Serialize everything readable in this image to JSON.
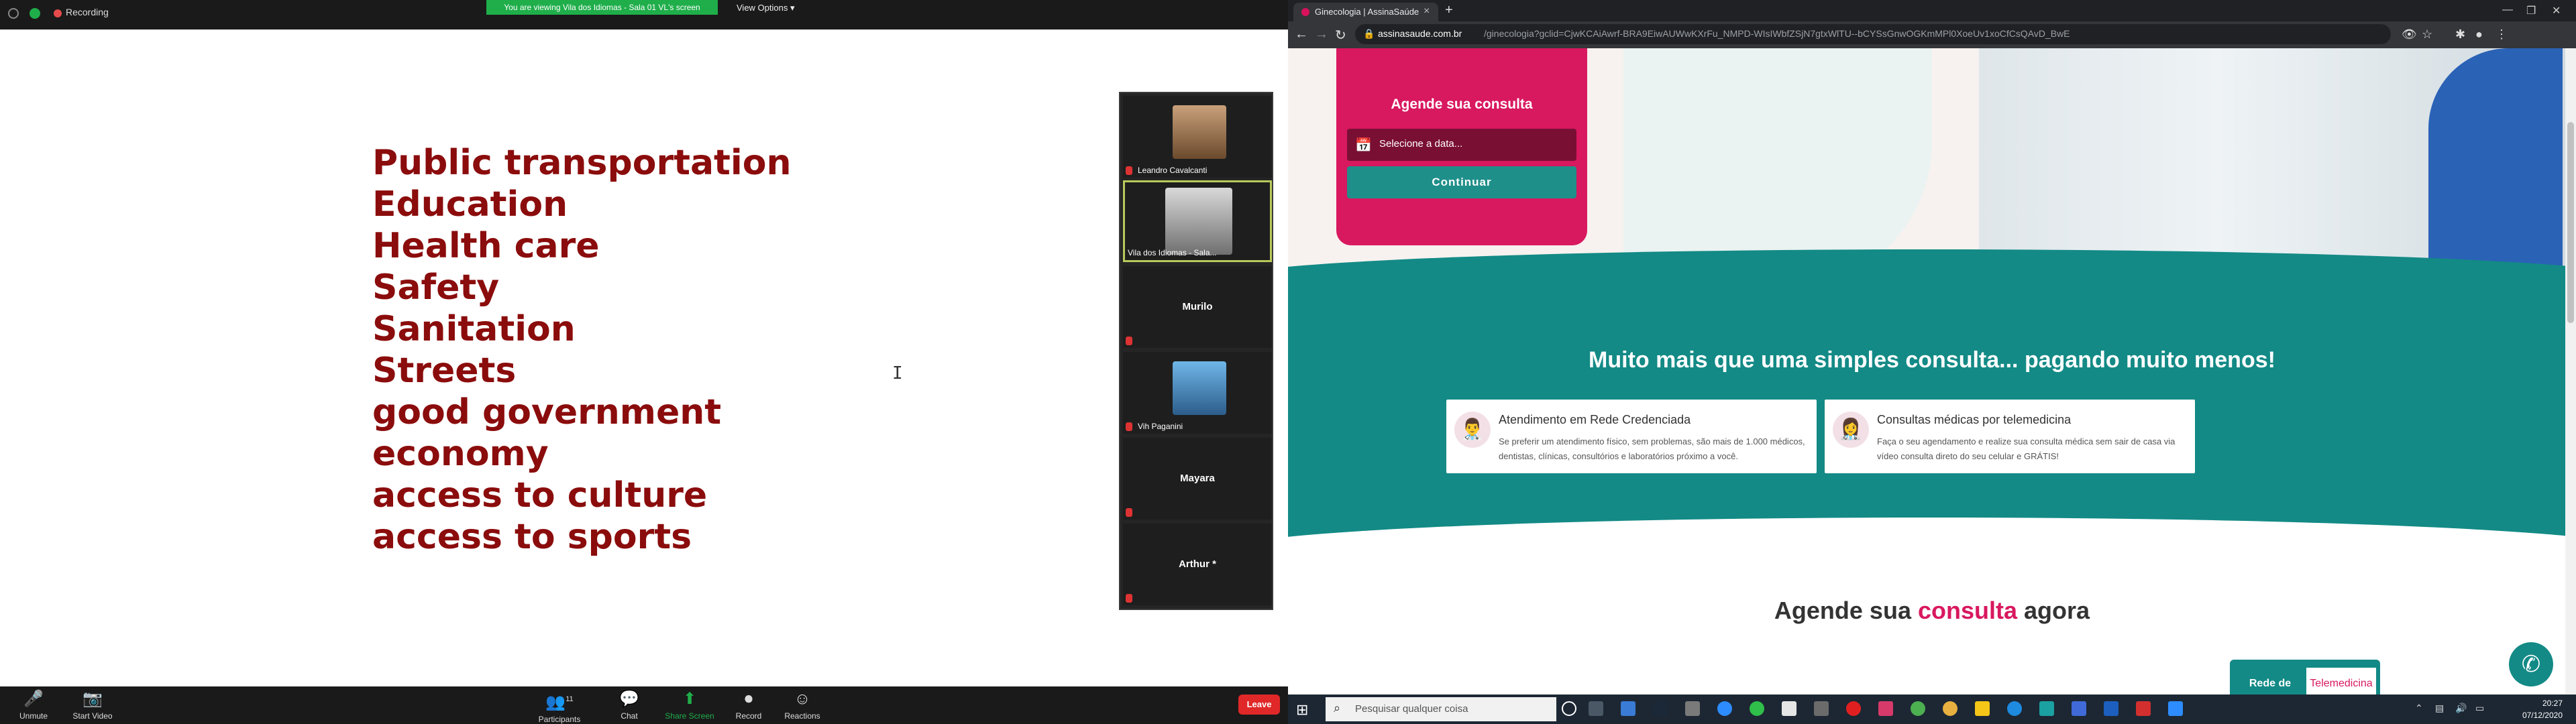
{
  "zoom": {
    "recording_label": "Recording",
    "viewing_banner": "You are viewing Vila dos Idiomas - Sala 01 VL's screen",
    "view_options": "View Options",
    "slide_lines": [
      "Public transportation",
      "Education",
      "Health care",
      "Safety",
      "Sanitation",
      "Streets",
      "good government",
      "economy",
      "access to culture",
      "access to sports"
    ],
    "participants": [
      {
        "name": "Leandro Cavalcanti",
        "center": ""
      },
      {
        "name": "Vila dos Idiomas - Sala...",
        "center": ""
      },
      {
        "name": "",
        "center": "Murilo"
      },
      {
        "name": "Vih Paganini",
        "center": ""
      },
      {
        "name": "",
        "center": "Mayara"
      },
      {
        "name": "",
        "center": "Arthur *"
      }
    ],
    "toolbar": {
      "unmute": "Unmute",
      "start_video": "Start Video",
      "participants": "Participants",
      "participants_count": "11",
      "chat": "Chat",
      "share_screen": "Share Screen",
      "record": "Record",
      "reactions": "Reactions",
      "leave": "Leave"
    }
  },
  "browser": {
    "tab_title": "Ginecologia | AssinaSaúde",
    "url_host": "assinasaude.com.br",
    "url_path": "/ginecologia?gclid=CjwKCAiAwrf-BRA9EiwAUWwKXrFu_NMPD-WIsIWbfZSjN7gtxWlTU--bCYSsGnwOGKmMPl0XoeUv1xoCfCsQAvD_BwE",
    "booking": {
      "title": "Agende sua consulta",
      "date_placeholder": "Selecione a data...",
      "continue": "Continuar"
    },
    "section_title": "Muito mais que uma simples consulta... pagando muito menos!",
    "features": [
      {
        "title": "Atendimento em Rede Credenciada",
        "desc": "Se preferir um atendimento físico, sem problemas, são mais de 1.000 médicos, dentistas, clínicas, consultórios e laboratórios próximo a você."
      },
      {
        "title": "Consultas médicas por telemedicina",
        "desc": "Faça o seu agendamento e realize sua consulta médica sem sair de casa via vídeo consulta direto do seu celular e GRÁTIS!"
      }
    ],
    "schedule_title_pre": "Agende sua ",
    "schedule_title_accent": "consulta",
    "schedule_title_post": " agora",
    "tabs": {
      "rede": "Rede de atendimento",
      "tele": "Telemedicina"
    }
  },
  "taskbar": {
    "search_placeholder": "Pesquisar qualquer coisa",
    "time": "20:27",
    "date": "07/12/2020"
  },
  "colors": {
    "slide_text": "#8b0c0c",
    "brand_pink": "#d8185f",
    "brand_teal": "#138a86",
    "zoom_green": "#1fae4a",
    "leave_red": "#e02828"
  }
}
